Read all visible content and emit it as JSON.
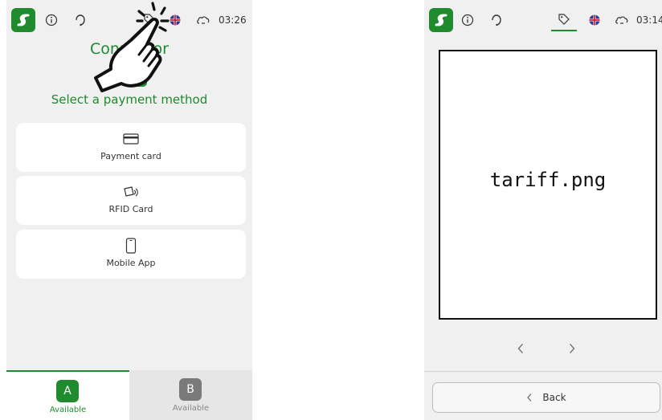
{
  "left_screen": {
    "status": {
      "time": "03:26"
    },
    "title": "Connector",
    "subtitle": "Select a payment method",
    "methods": [
      {
        "label": "Payment card",
        "icon": "credit-card-icon"
      },
      {
        "label": "RFID Card",
        "icon": "rfid-card-icon"
      },
      {
        "label": "Mobile App",
        "icon": "mobile-phone-icon"
      }
    ],
    "tabs": [
      {
        "letter": "A",
        "status": "Available",
        "selected": true
      },
      {
        "letter": "B",
        "status": "Available",
        "selected": false
      }
    ]
  },
  "right_screen": {
    "status": {
      "time": "03:14"
    },
    "tariff_image_label": "tariff.png",
    "back_label": "Back"
  },
  "colors": {
    "brand_green": "#1f8a2e",
    "background": "#f0f0f0",
    "card": "#ffffff",
    "tab_inactive": "#e6e6e6",
    "badge_inactive": "#7a7a7a"
  }
}
